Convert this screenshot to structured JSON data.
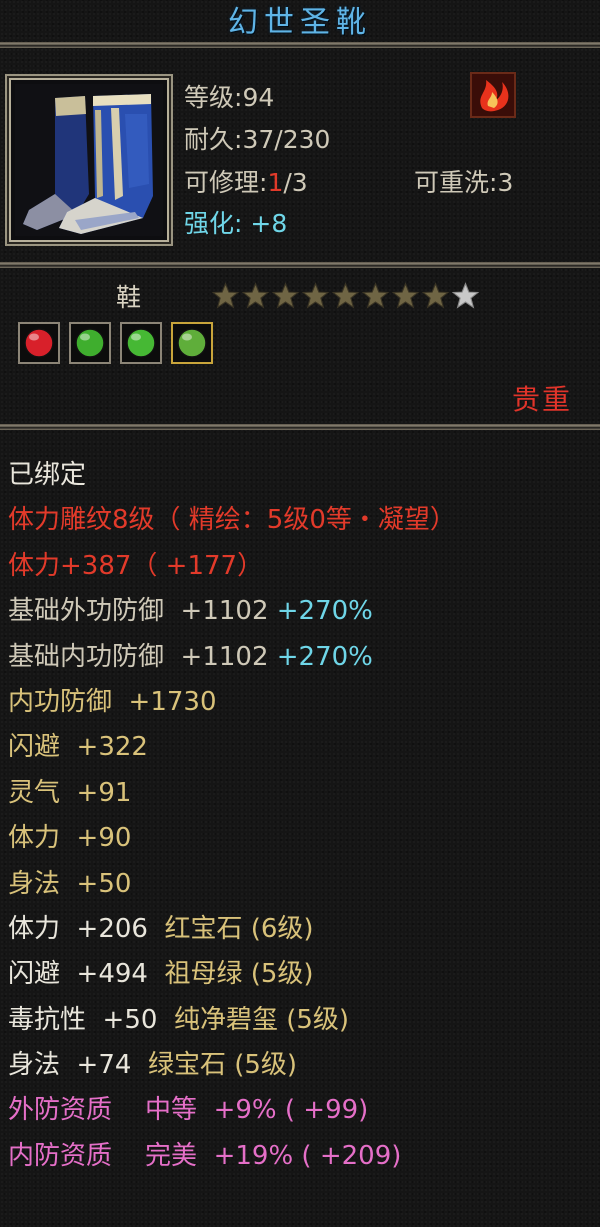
{
  "colors": {
    "title": "#5fb4e6",
    "white": "#e9e6dc",
    "red": "#e23a2a",
    "gray": "#cfc9b8",
    "gold": "#d9c27a",
    "cyan": "#6fd6e8",
    "pink": "#e56fc8",
    "star_lit": "#6f6544",
    "star_dim": "#c8c8c8"
  },
  "item": {
    "name": "幻世圣靴",
    "level_label": "等级",
    "level_value": "94",
    "durability_label": "耐久",
    "durability_value": "37/230",
    "repair_label": "可修理",
    "repair_current": "1",
    "repair_max": "/3",
    "rewash_label": "可重洗",
    "rewash_value": "3",
    "enhance_label": "强化",
    "enhance_value": "+8",
    "type": "鞋",
    "rarity": "贵重",
    "icon": "boots-icon",
    "rune_icon": "flame-rune-icon"
  },
  "stars": {
    "lit": 8,
    "total": 9
  },
  "gems": [
    {
      "name": "red-gem-icon",
      "color": "#d8202a",
      "frame": "#8c8577"
    },
    {
      "name": "green-gem-icon",
      "color": "#3fae2e",
      "frame": "#8c8577"
    },
    {
      "name": "green-gem-icon",
      "color": "#46b834",
      "frame": "#8c8577"
    },
    {
      "name": "jade-gem-icon",
      "color": "#5fae3a",
      "frame": "#c9a53b"
    }
  ],
  "properties": [
    {
      "segments": [
        {
          "text": "已绑定",
          "color": "white"
        }
      ]
    },
    {
      "segments": [
        {
          "text": "体力雕纹8级（ 精绘：5级0等・凝望）",
          "color": "red"
        }
      ]
    },
    {
      "segments": [
        {
          "text": "体力+387（ +177）",
          "color": "red"
        }
      ]
    },
    {
      "segments": [
        {
          "text": "基础外功防御  +1102 ",
          "color": "gray"
        },
        {
          "text": "+270%",
          "color": "cyan"
        }
      ]
    },
    {
      "segments": [
        {
          "text": "基础内功防御  +1102 ",
          "color": "gray"
        },
        {
          "text": "+270%",
          "color": "cyan"
        }
      ]
    },
    {
      "segments": [
        {
          "text": "内功防御  +1730",
          "color": "gold"
        }
      ]
    },
    {
      "segments": [
        {
          "text": "闪避  +322",
          "color": "gold"
        }
      ]
    },
    {
      "segments": [
        {
          "text": "灵气  +91",
          "color": "gold"
        }
      ]
    },
    {
      "segments": [
        {
          "text": "体力  +90",
          "color": "gold"
        }
      ]
    },
    {
      "segments": [
        {
          "text": "身法  +50",
          "color": "gold"
        }
      ]
    },
    {
      "segments": [
        {
          "text": "体力  +206  ",
          "color": "white"
        },
        {
          "text": "红宝石 (6级)",
          "color": "gold"
        }
      ]
    },
    {
      "segments": [
        {
          "text": "闪避  +494  ",
          "color": "white"
        },
        {
          "text": "祖母绿 (5级)",
          "color": "gold"
        }
      ]
    },
    {
      "segments": [
        {
          "text": "毒抗性  +50  ",
          "color": "white"
        },
        {
          "text": "纯净碧玺 (5级)",
          "color": "gold"
        }
      ]
    },
    {
      "segments": [
        {
          "text": "身法  +74  ",
          "color": "white"
        },
        {
          "text": "绿宝石 (5级)",
          "color": "gold"
        }
      ]
    },
    {
      "segments": [
        {
          "text": "外防资质    中等  +9% ( +99)",
          "color": "pink"
        }
      ]
    },
    {
      "segments": [
        {
          "text": "内防资质    完美  +19% ( +209)",
          "color": "pink"
        }
      ]
    }
  ]
}
